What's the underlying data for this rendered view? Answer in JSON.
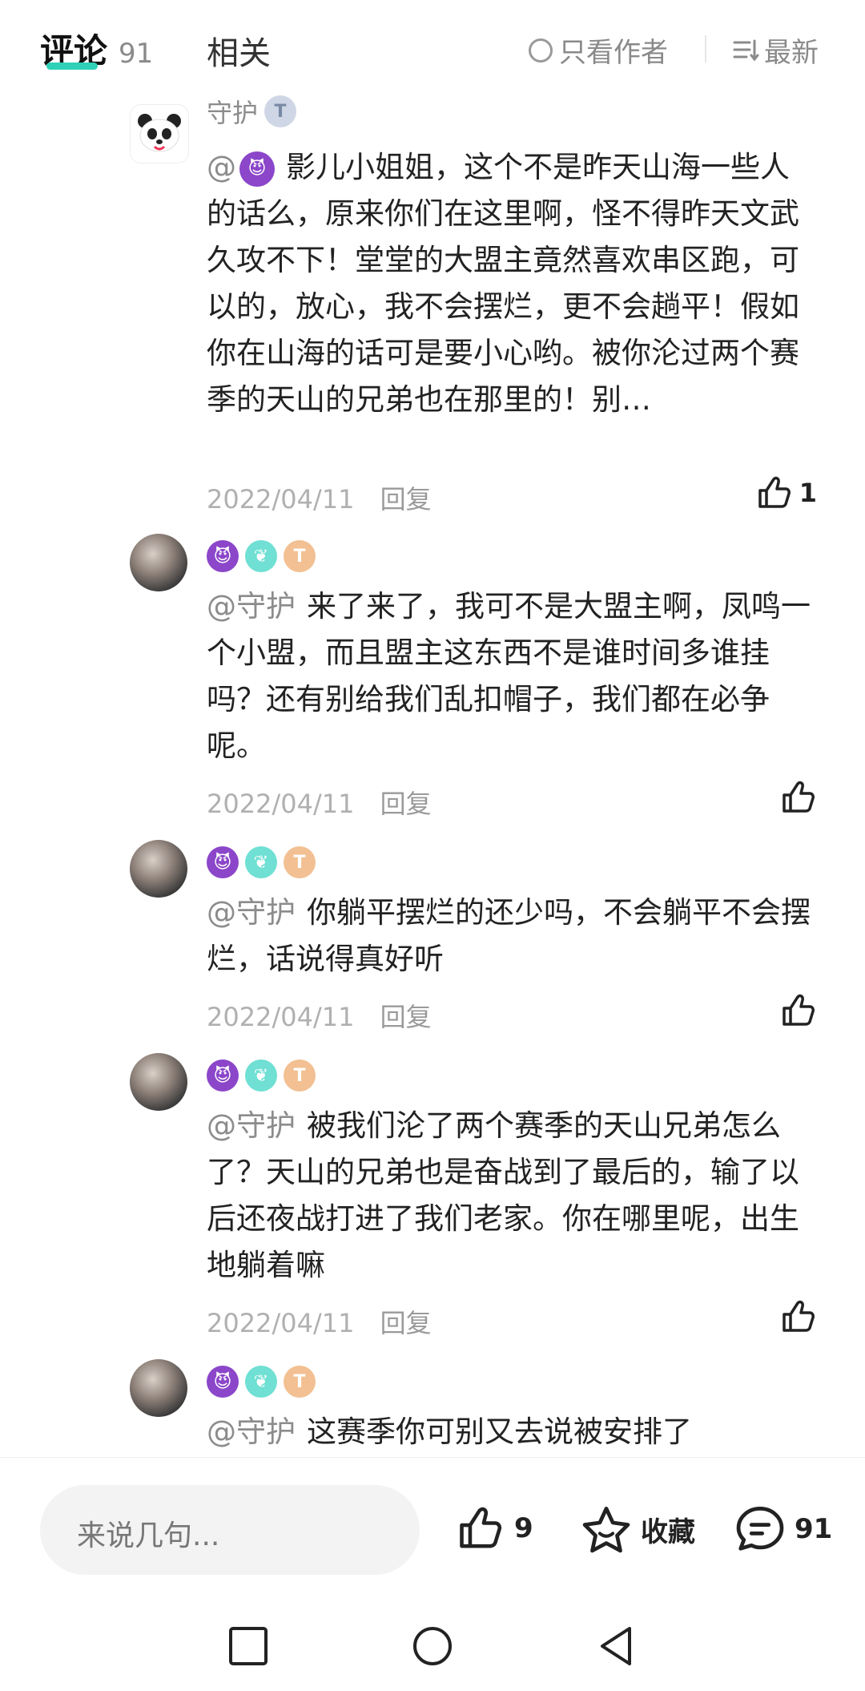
{
  "header": {
    "tab_comments": "评论",
    "comment_count": "91",
    "tab_related": "相关",
    "author_only": "只看作者",
    "sort_label": "最新"
  },
  "comments": [
    {
      "name": "守护",
      "badge": "T",
      "mention": "@",
      "text": "影儿小姐姐，这个不是昨天山海一些人的话么，原来你们在这里啊，怪不得昨天文武久攻不下！堂堂的大盟主竟然喜欢串区跑，可以的，放心，我不会摆烂，更不会趟平！假如你在山海的话可是要小心哟。被你沦过两个赛季的天山的兄弟也在那里的！别…",
      "date": "2022/04/11",
      "reply": "回复",
      "likes": "1"
    },
    {
      "mention": "@守护",
      "text": "来了来了，我可不是大盟主啊，凤鸣一个小盟，而且盟主这东西不是谁时间多谁挂吗？还有别给我们乱扣帽子，我们都在必争呢。",
      "date": "2022/04/11",
      "reply": "回复"
    },
    {
      "mention": "@守护",
      "text": "你躺平摆烂的还少吗，不会躺平不会摆烂，话说得真好听",
      "date": "2022/04/11",
      "reply": "回复"
    },
    {
      "mention": "@守护",
      "text": "被我们沦了两个赛季的天山兄弟怎么了？天山的兄弟也是奋战到了最后的，输了以后还夜战打进了我们老家。你在哪里呢，出生地躺着嘛",
      "date": "2022/04/11",
      "reply": "回复"
    },
    {
      "mention": "@守护",
      "text": "这赛季你可别又去说被安排了"
    }
  ],
  "bottom": {
    "input_placeholder": "来说几句...",
    "likes": "9",
    "favorite": "收藏",
    "comments": "91"
  },
  "colors": {
    "accent": "#2fd2b8",
    "devil_badge": "#8b46c9",
    "teal_badge": "#6fe0d3",
    "gold_badge": "#f2c092"
  }
}
